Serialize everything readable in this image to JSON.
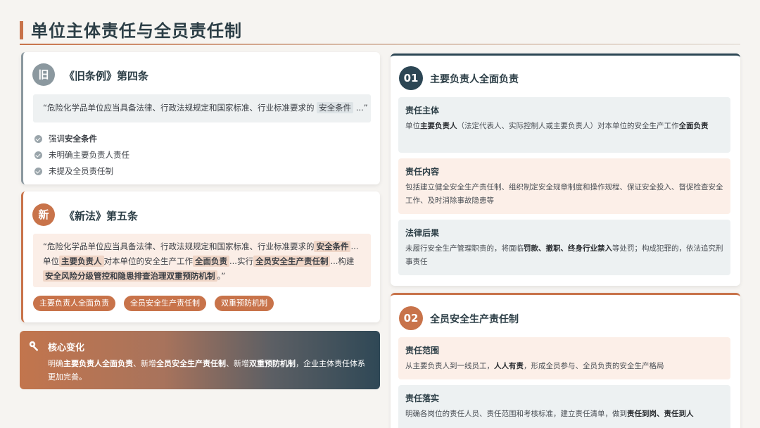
{
  "page": {
    "title": "单位主体责任与全员责任制"
  },
  "old": {
    "badge": "旧",
    "title": "《旧条例》第四条",
    "quote_pre": "“危险化学品单位应当具备法律、行政法规规定和国家标准、行业标准要求的",
    "quote_hl": "安全条件",
    "quote_post": "...”",
    "bullets": [
      {
        "pre": "强调",
        "bold": "安全条件"
      },
      {
        "text": "未明确主要负责人责任"
      },
      {
        "text": "未提及全员责任制"
      }
    ]
  },
  "new": {
    "badge": "新",
    "title": "《新法》第五条",
    "quote": {
      "t1": "“危险化学品单位应当具备法律、行政法规规定和国家标准、行业标准要求的",
      "h1": "安全条件",
      "t2": "...单位",
      "h2": "主要负责人",
      "t3": "对本单位的安全生产工作",
      "h3": "全面负责",
      "t4": "...实行",
      "h4": "全员安全生产责任制",
      "t5": "...构建",
      "h5": "安全风险分级管控和隐患排查治理双重预防机制",
      "t6": "。”"
    },
    "tags": [
      "主要负责人全面负责",
      "全员安全生产责任制",
      "双重预防机制"
    ]
  },
  "core": {
    "title": "核心变化",
    "body": {
      "a": "明确",
      "b": "主要负责人全面负责",
      "c": "、新增",
      "d": "全员安全生产责任制",
      "e": "、新增",
      "f": "双重预防机制",
      "g": "，企业主体责任体系更加完善。"
    }
  },
  "section1": {
    "number": "01",
    "title": "主要负责人全面负责",
    "boxes": [
      {
        "title": "责任主体",
        "t1": "单位",
        "b1": "主要负责人",
        "t2": "（法定代表人、实际控制人或主要负责人）对本单位的安全生产工作",
        "b2": "全面负责"
      },
      {
        "title": "责任内容",
        "text": "包括建立健全安全生产责任制、组织制定安全规章制度和操作规程、保证安全投入、督促检查安全工作、及时消除事故隐患等"
      },
      {
        "title": "法律后果",
        "t1": "未履行安全生产管理职责的，将面临",
        "b1": "罚款、撤职、终身行业禁入",
        "t2": "等处罚；构成犯罪的，依法追究刑事责任"
      }
    ]
  },
  "section2": {
    "number": "02",
    "title": "全员安全生产责任制",
    "boxes": [
      {
        "title": "责任范围",
        "t1": "从主要负责人到一线员工，",
        "b1": "人人有责",
        "t2": "，形成全员参与、全员负责的安全生产格局"
      },
      {
        "title": "责任落实",
        "t1": "明确各岗位的责任人员、责任范围和考核标准，建立责任清单，做到",
        "b1": "责任到岗、责任到人"
      }
    ]
  },
  "colors": {
    "accent": "#c8734a",
    "dark": "#2c4654",
    "grey": "#8b989f"
  }
}
